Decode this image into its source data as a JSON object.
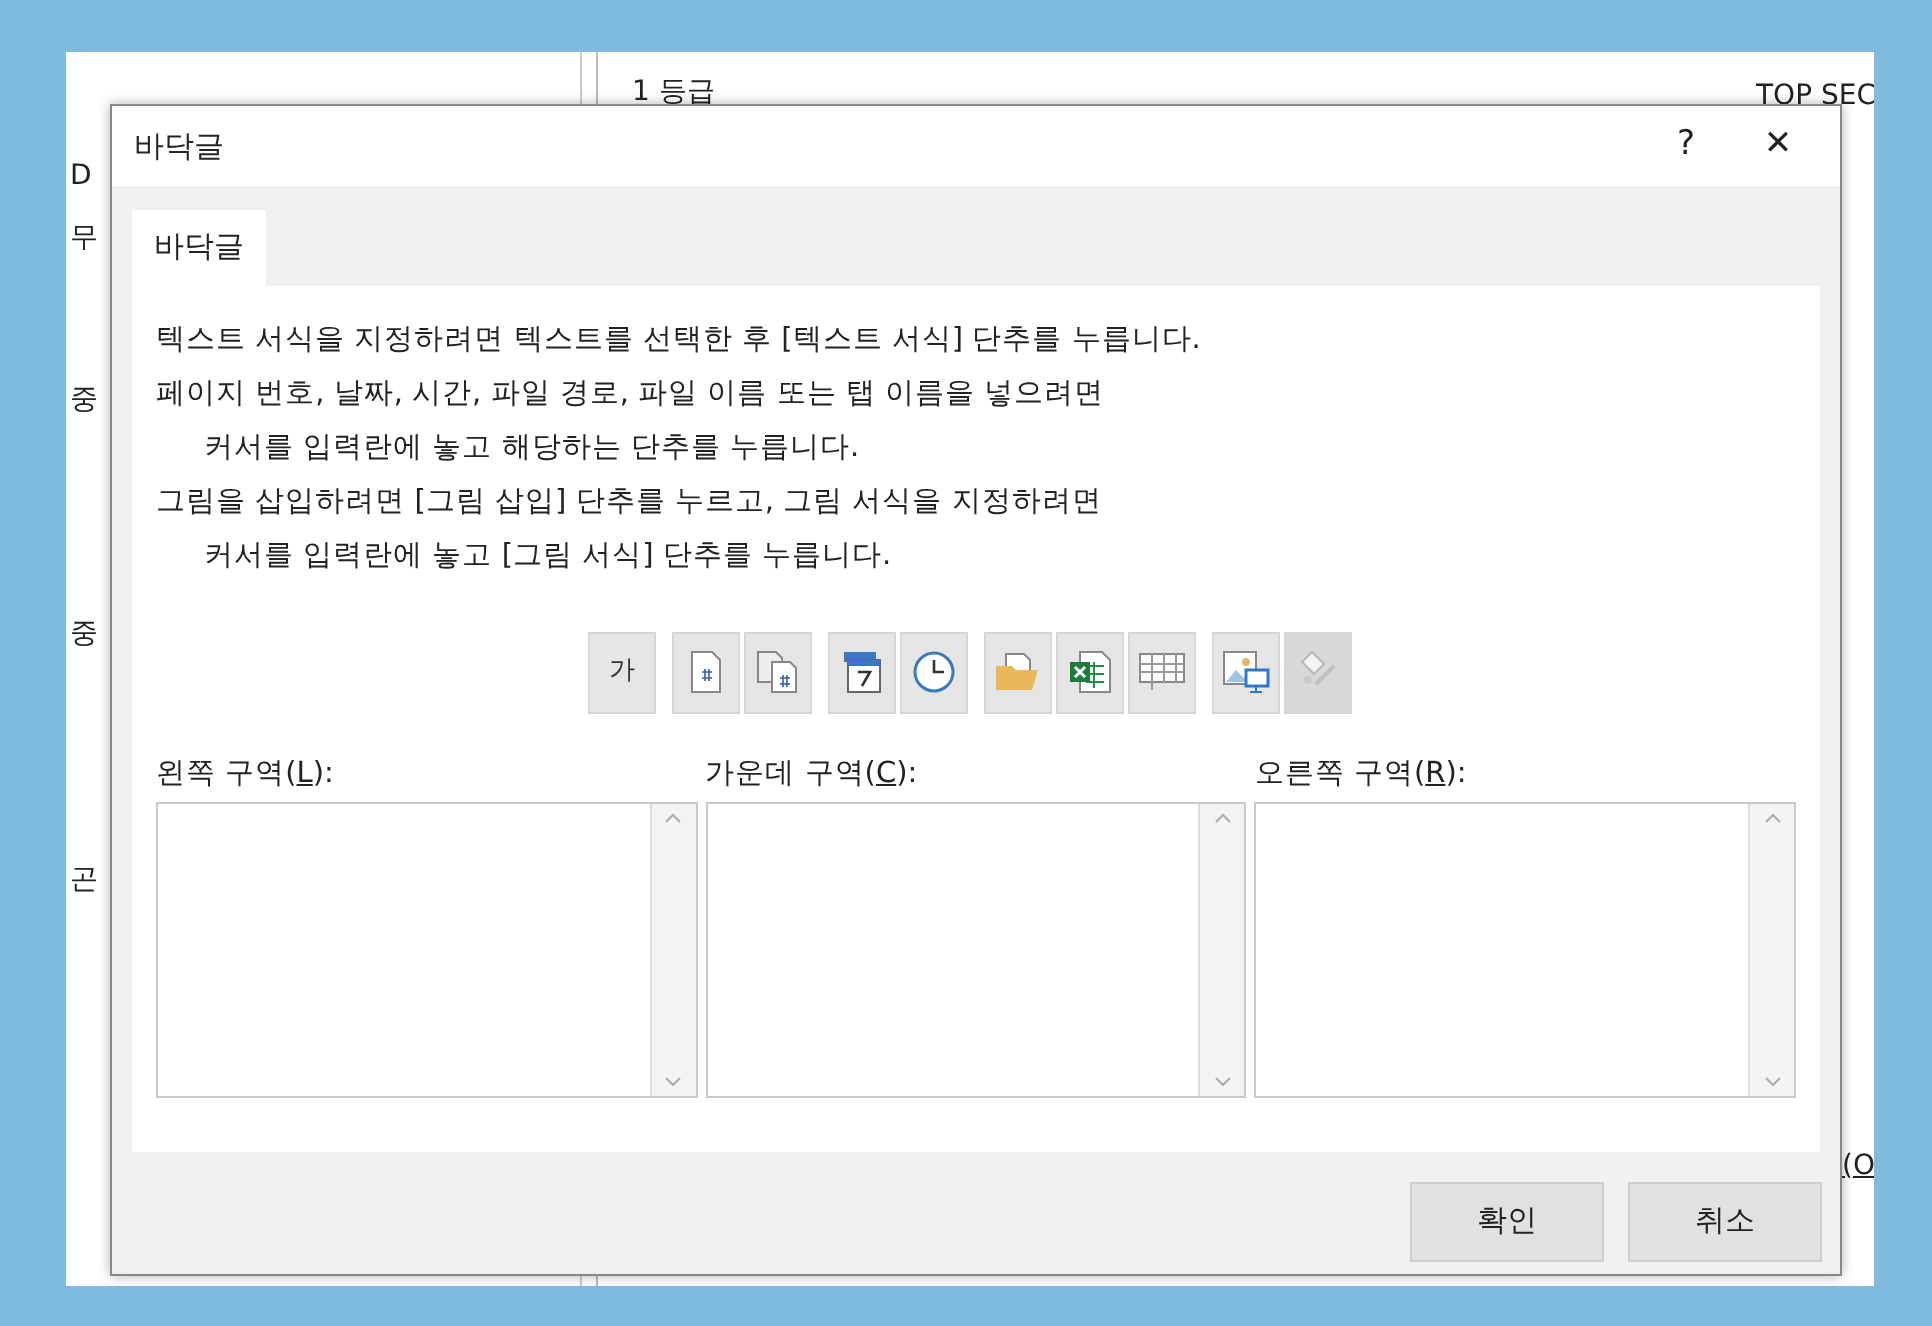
{
  "background_sheet": {
    "left_fragments": [
      "D",
      "무",
      "중",
      "중",
      "곤"
    ],
    "header_left": "1 등급",
    "header_right": "TOP SEC",
    "bottom_right": "(O"
  },
  "window": {
    "title": "바닥글",
    "help": "?",
    "close": "✕"
  },
  "tabs": [
    {
      "label": "바닥글",
      "selected": true
    }
  ],
  "instructions": [
    {
      "text": "텍스트 서식을 지정하려면 텍스트를 선택한 후 [텍스트 서식] 단추를 누릅니다.",
      "indented": false
    },
    {
      "text": "페이지 번호, 날짜, 시간, 파일 경로, 파일 이름 또는 탭 이름을 넣으려면",
      "indented": false
    },
    {
      "text": "커서를 입력란에 놓고 해당하는 단추를 누릅니다.",
      "indented": true
    },
    {
      "text": "그림을 삽입하려면 [그림 삽입] 단추를 누르고, 그림 서식을 지정하려면",
      "indented": false
    },
    {
      "text": "커서를 입력란에 놓고 [그림 서식] 단추를 누릅니다.",
      "indented": true
    }
  ],
  "toolbar_groups": [
    [
      {
        "kind": "text",
        "label": "가",
        "disabled": false
      }
    ],
    [
      {
        "kind": "page",
        "disabled": false
      },
      {
        "kind": "pages",
        "disabled": false
      }
    ],
    [
      {
        "kind": "calendar",
        "disabled": false
      },
      {
        "kind": "clock",
        "disabled": false
      }
    ],
    [
      {
        "kind": "folder",
        "disabled": false
      },
      {
        "kind": "spreadsheet",
        "disabled": false
      },
      {
        "kind": "grid",
        "disabled": false
      }
    ],
    [
      {
        "kind": "image",
        "disabled": false
      },
      {
        "kind": "paint",
        "disabled": true
      }
    ]
  ],
  "sections": [
    {
      "text_before": "왼쪽 구역(",
      "access_key": "L",
      "text_after": "):"
    },
    {
      "text_before": "가운데 구역(",
      "access_key": "C",
      "text_after": "):"
    },
    {
      "text_before": "오른쪽 구역(",
      "access_key": "R",
      "text_after": "):"
    }
  ],
  "buttons": [
    {
      "label": "확인"
    },
    {
      "label": "취소"
    }
  ]
}
